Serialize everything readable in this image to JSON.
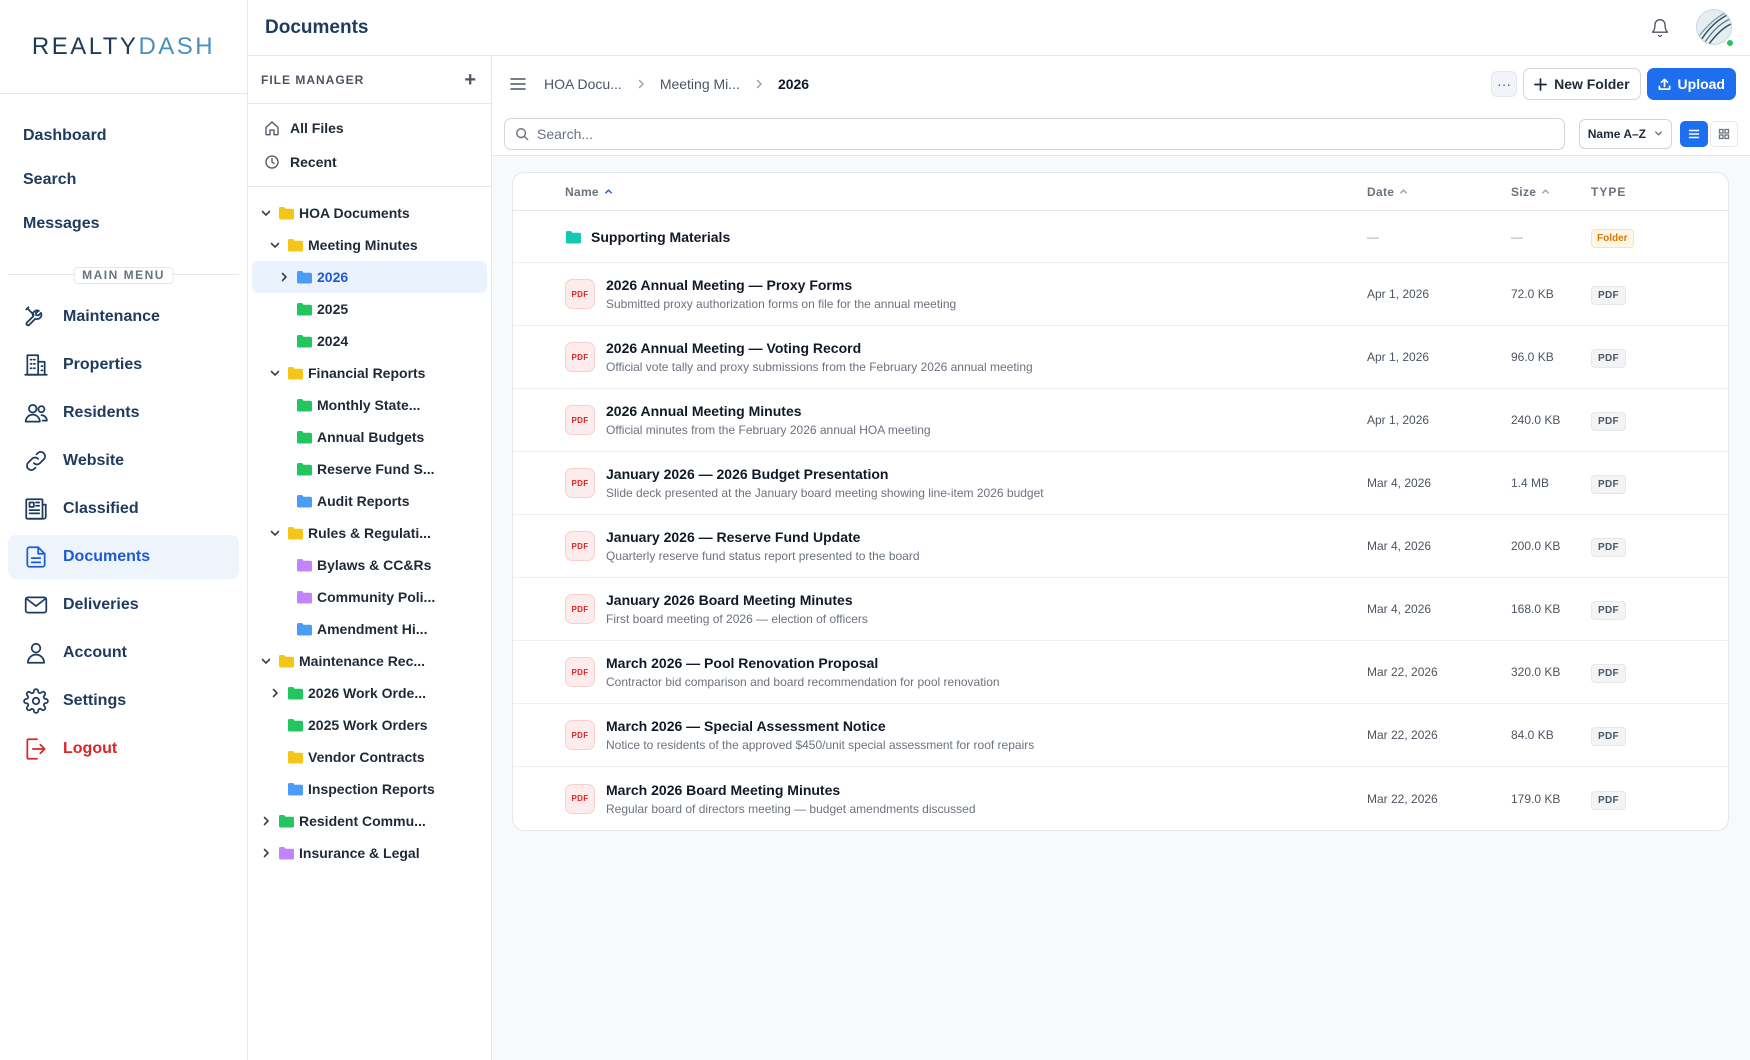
{
  "brand": {
    "logo_text_a": "REALTY",
    "logo_text_b": "DASH"
  },
  "nav": {
    "top": [
      {
        "label": "Dashboard"
      },
      {
        "label": "Search"
      },
      {
        "label": "Messages"
      }
    ],
    "section_label": "MAIN MENU",
    "items": [
      {
        "label": "Maintenance",
        "icon": "tools-icon"
      },
      {
        "label": "Properties",
        "icon": "building-icon"
      },
      {
        "label": "Residents",
        "icon": "users-icon"
      },
      {
        "label": "Website",
        "icon": "link-icon"
      },
      {
        "label": "Classified",
        "icon": "newspaper-icon"
      },
      {
        "label": "Documents",
        "icon": "document-icon",
        "active": true
      },
      {
        "label": "Deliveries",
        "icon": "mail-icon"
      },
      {
        "label": "Account",
        "icon": "user-icon"
      },
      {
        "label": "Settings",
        "icon": "gear-icon"
      },
      {
        "label": "Logout",
        "icon": "logout-icon"
      }
    ]
  },
  "header": {
    "title": "Documents"
  },
  "file_manager": {
    "title": "FILE MANAGER",
    "quick": [
      {
        "label": "All Files",
        "icon": "home-icon"
      },
      {
        "label": "Recent",
        "icon": "clock-icon"
      }
    ],
    "tree": [
      {
        "label": "HOA Documents",
        "depth": 0,
        "chev": "down",
        "color": "#f5c518"
      },
      {
        "label": "Meeting Minutes",
        "depth": 1,
        "chev": "down",
        "color": "#f5c518"
      },
      {
        "label": "2026",
        "depth": 2,
        "chev": "right",
        "color": "#4b9cf5",
        "selected": true
      },
      {
        "label": "2025",
        "depth": 2,
        "chev": "none",
        "color": "#22c55e"
      },
      {
        "label": "2024",
        "depth": 2,
        "chev": "none",
        "color": "#22c55e"
      },
      {
        "label": "Financial Reports",
        "depth": 1,
        "chev": "down",
        "color": "#f5c518"
      },
      {
        "label": "Monthly State...",
        "depth": 2,
        "chev": "none",
        "color": "#22c55e"
      },
      {
        "label": "Annual Budgets",
        "depth": 2,
        "chev": "none",
        "color": "#22c55e"
      },
      {
        "label": "Reserve Fund S...",
        "depth": 2,
        "chev": "none",
        "color": "#22c55e"
      },
      {
        "label": "Audit Reports",
        "depth": 2,
        "chev": "none",
        "color": "#4b9cf5"
      },
      {
        "label": "Rules & Regulati...",
        "depth": 1,
        "chev": "down",
        "color": "#f5c518"
      },
      {
        "label": "Bylaws & CC&Rs",
        "depth": 2,
        "chev": "none",
        "color": "#c084fc"
      },
      {
        "label": "Community Poli...",
        "depth": 2,
        "chev": "none",
        "color": "#c084fc"
      },
      {
        "label": "Amendment Hi...",
        "depth": 2,
        "chev": "none",
        "color": "#4b9cf5"
      },
      {
        "label": "Maintenance Rec...",
        "depth": 0,
        "chev": "down",
        "color": "#f5c518"
      },
      {
        "label": "2026 Work Orde...",
        "depth": 1,
        "chev": "right",
        "color": "#22c55e"
      },
      {
        "label": "2025 Work Orders",
        "depth": 1,
        "chev": "none",
        "color": "#22c55e"
      },
      {
        "label": "Vendor Contracts",
        "depth": 1,
        "chev": "none",
        "color": "#f5c518"
      },
      {
        "label": "Inspection Reports",
        "depth": 1,
        "chev": "none",
        "color": "#4b9cf5"
      },
      {
        "label": "Resident Commu...",
        "depth": 0,
        "chev": "right",
        "color": "#22c55e"
      },
      {
        "label": "Insurance & Legal",
        "depth": 0,
        "chev": "right",
        "color": "#c084fc"
      }
    ]
  },
  "toolbar": {
    "breadcrumb": [
      "HOA Docu...",
      "Meeting Mi...",
      "2026"
    ],
    "more_label": "···",
    "new_folder_label": "New Folder",
    "upload_label": "Upload",
    "search_placeholder": "Search...",
    "sort_label": "Name A–Z"
  },
  "table": {
    "columns": {
      "name": "Name",
      "date": "Date",
      "size": "Size",
      "type": "TYPE"
    },
    "folder": {
      "name": "Supporting Materials",
      "date": "—",
      "size": "—",
      "type": "Folder",
      "color": "#14c8b4"
    },
    "files": [
      {
        "icon_label": "PDF",
        "title": "2026 Annual Meeting — Proxy Forms",
        "desc": "Submitted proxy authorization forms on file for the annual meeting",
        "date": "Apr 1, 2026",
        "size": "72.0 KB",
        "type": "PDF"
      },
      {
        "icon_label": "PDF",
        "title": "2026 Annual Meeting — Voting Record",
        "desc": "Official vote tally and proxy submissions from the February 2026 annual meeting",
        "date": "Apr 1, 2026",
        "size": "96.0 KB",
        "type": "PDF"
      },
      {
        "icon_label": "PDF",
        "title": "2026 Annual Meeting Minutes",
        "desc": "Official minutes from the February 2026 annual HOA meeting",
        "date": "Apr 1, 2026",
        "size": "240.0 KB",
        "type": "PDF"
      },
      {
        "icon_label": "PDF",
        "title": "January 2026 — 2026 Budget Presentation",
        "desc": "Slide deck presented at the January board meeting showing line-item 2026 budget",
        "date": "Mar 4, 2026",
        "size": "1.4 MB",
        "type": "PDF"
      },
      {
        "icon_label": "PDF",
        "title": "January 2026 — Reserve Fund Update",
        "desc": "Quarterly reserve fund status report presented to the board",
        "date": "Mar 4, 2026",
        "size": "200.0 KB",
        "type": "PDF"
      },
      {
        "icon_label": "PDF",
        "title": "January 2026 Board Meeting Minutes",
        "desc": "First board meeting of 2026 — election of officers",
        "date": "Mar 4, 2026",
        "size": "168.0 KB",
        "type": "PDF"
      },
      {
        "icon_label": "PDF",
        "title": "March 2026 — Pool Renovation Proposal",
        "desc": "Contractor bid comparison and board recommendation for pool renovation",
        "date": "Mar 22, 2026",
        "size": "320.0 KB",
        "type": "PDF"
      },
      {
        "icon_label": "PDF",
        "title": "March 2026 — Special Assessment Notice",
        "desc": "Notice to residents of the approved $450/unit special assessment for roof repairs",
        "date": "Mar 22, 2026",
        "size": "84.0 KB",
        "type": "PDF"
      },
      {
        "icon_label": "PDF",
        "title": "March 2026 Board Meeting Minutes",
        "desc": "Regular board of directors meeting — budget amendments discussed",
        "date": "Mar 22, 2026",
        "size": "179.0 KB",
        "type": "PDF"
      }
    ]
  },
  "colors": {
    "accent": "#1e6ff0",
    "nav_text": "#1e3a5f",
    "logout": "#dc2626",
    "pdf_red": "#dc2626"
  }
}
